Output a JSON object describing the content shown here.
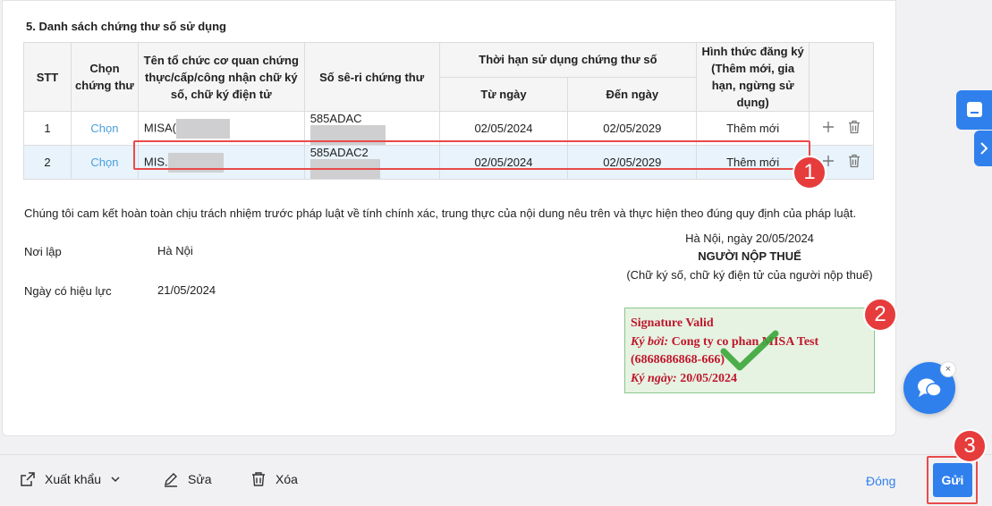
{
  "section": {
    "title": "5. Danh sách chứng thư số sử dụng"
  },
  "table": {
    "headers": {
      "stt": "STT",
      "choose": "Chọn chứng thư",
      "org": "Tên tổ chức cơ quan chứng thực/cấp/công nhận chữ ký số, chữ ký điện tử",
      "serial": "Số sê-ri chứng thư",
      "validity": "Thời hạn sử dụng chứng thư số",
      "from": "Từ ngày",
      "to": "Đến ngày",
      "form": "Hình thức đăng ký (Thêm mới, gia hạn, ngừng sử dụng)"
    },
    "rows": [
      {
        "stt": "1",
        "choose": "Chọn",
        "org": "MISA(",
        "serial": "585ADAC",
        "from": "02/05/2024",
        "to": "02/05/2029",
        "form": "Thêm mới"
      },
      {
        "stt": "2",
        "choose": "Chọn",
        "org": "MIS.",
        "serial": "585ADAC2",
        "from": "02/05/2024",
        "to": "02/05/2029",
        "form": "Thêm mới"
      }
    ]
  },
  "commitment": "Chúng tôi cam kết hoàn toàn chịu trách nhiệm trước pháp luật về tính chính xác, trung thực của nội dung nêu trên và thực hiện theo đúng quy định của pháp luật.",
  "place": {
    "label": "Nơi lập",
    "value": "Hà Nội"
  },
  "effective": {
    "label": "Ngày có hiệu lực",
    "value": "21/05/2024"
  },
  "signer": {
    "date_line": "Hà Nội, ngày 20/05/2024",
    "title": "NGƯỜI NỘP THUẾ",
    "note": "(Chữ ký số, chữ ký điện tử của người nộp thuế)"
  },
  "signature": {
    "line1": "Signature Valid",
    "signed_by_label": "Ký bởi:",
    "signed_by": "Cong ty co phan MISA Test",
    "tax_code": "(6868686868-666)",
    "signed_date_label": "Ký ngày:",
    "signed_date": "20/05/2024"
  },
  "badges": {
    "b1": "1",
    "b2": "2",
    "b3": "3"
  },
  "footer": {
    "export": "Xuất khẩu",
    "edit": "Sửa",
    "delete": "Xóa",
    "close": "Đóng",
    "send": "Gửi"
  },
  "chat_close": "×",
  "colors": {
    "primary": "#2f80ed",
    "highlight": "#e94a4a",
    "link": "#4a9fdc",
    "signature_text": "#c0162c"
  },
  "icons": {
    "export": "export-icon",
    "chevron": "chevron-down-icon",
    "edit": "pencil-icon",
    "delete": "trash-icon",
    "add": "plus-icon",
    "chat": "chat-icon",
    "check": "checkmark-icon"
  }
}
